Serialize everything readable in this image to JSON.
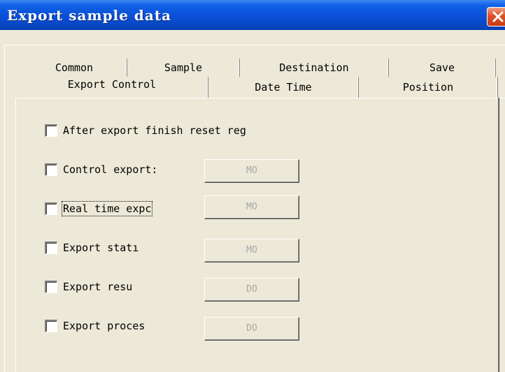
{
  "window": {
    "title": "Export sample data"
  },
  "tabs": {
    "row1": [
      "Common",
      "Sample",
      "Destination",
      "Save"
    ],
    "row2": [
      "Export Control",
      "Date Time",
      "Position"
    ],
    "active": "Export Control"
  },
  "options": [
    {
      "label": "After export finish reset reg",
      "checked": false
    },
    {
      "label": "Control export:",
      "checked": false,
      "register": "MO"
    },
    {
      "label": "Real time expc",
      "checked": false,
      "register": "MO"
    },
    {
      "label": "Export statı",
      "checked": false,
      "register": "MO"
    },
    {
      "label": "Export resu",
      "checked": false,
      "register": "DO"
    },
    {
      "label": "Export proces",
      "checked": false,
      "register": "DO"
    }
  ],
  "colors": {
    "title_bar": "#0a4fd6",
    "dialog_bg": "#ece9d8",
    "close_button": "#e0502a"
  },
  "icons": {
    "close": "close-icon"
  }
}
